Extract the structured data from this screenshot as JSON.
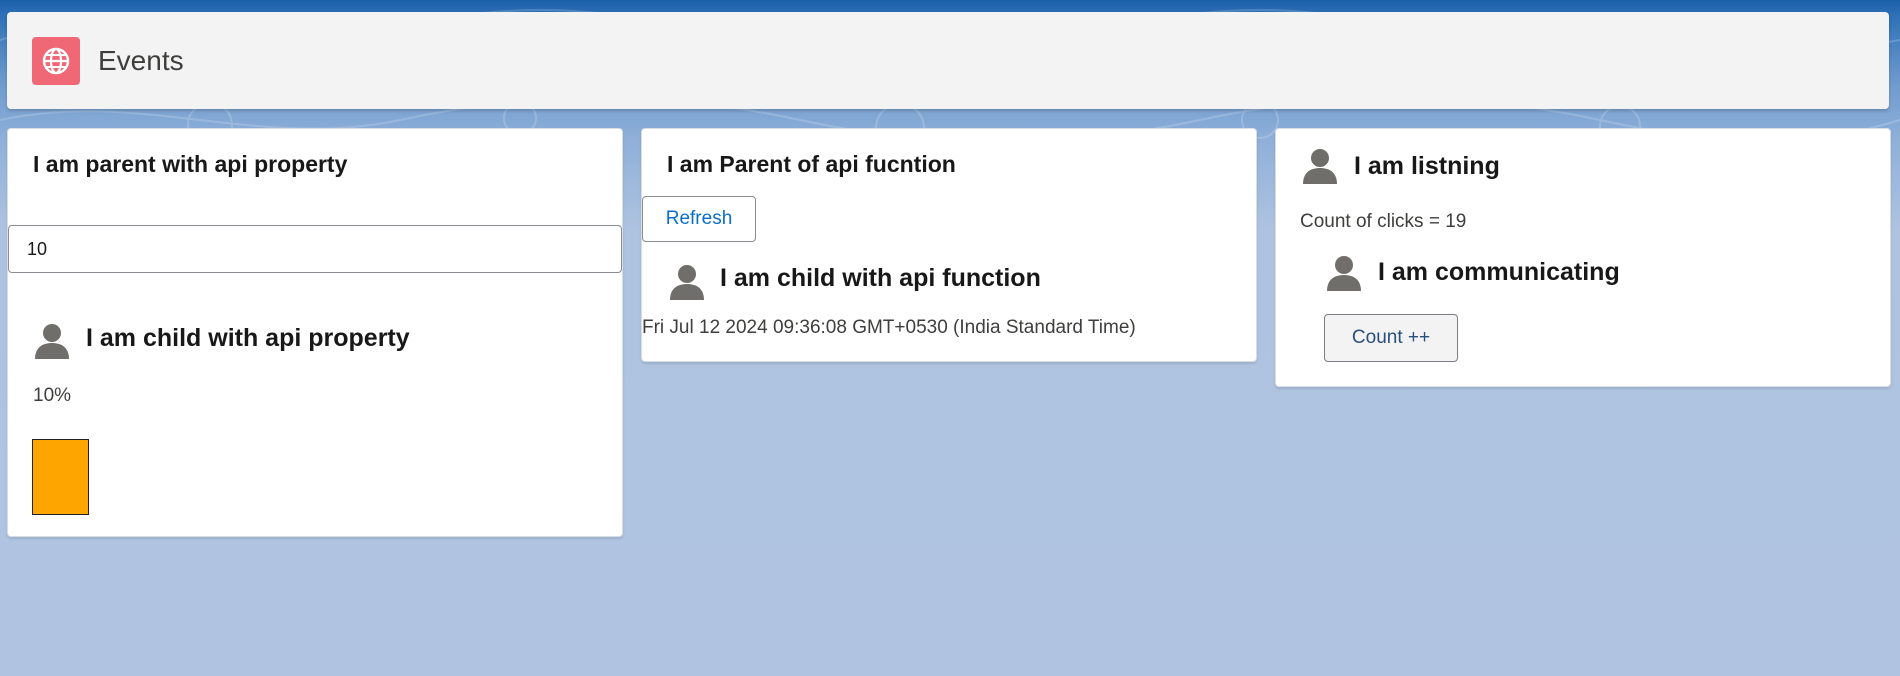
{
  "header": {
    "title": "Events",
    "icon": "globe-icon",
    "icon_color": "#f06876"
  },
  "card1": {
    "title": "I am parent with api property",
    "input_value": "10",
    "child": {
      "title": "I am child with api property",
      "icon": "person-icon",
      "percent_label": "10%",
      "fill_color": "#ffa500"
    }
  },
  "card2": {
    "title": "I am Parent of api fucntion",
    "refresh_label": "Refresh",
    "child": {
      "title": "I am child with api function",
      "icon": "person-icon",
      "timestamp": "Fri Jul 12 2024 09:36:08 GMT+0530 (India Standard Time)"
    }
  },
  "card3": {
    "title": "I am listning",
    "icon": "person-icon",
    "count_text": "Count of clicks = 19",
    "child": {
      "title": "I am communicating",
      "icon": "person-icon",
      "button_label": "Count ++"
    }
  }
}
